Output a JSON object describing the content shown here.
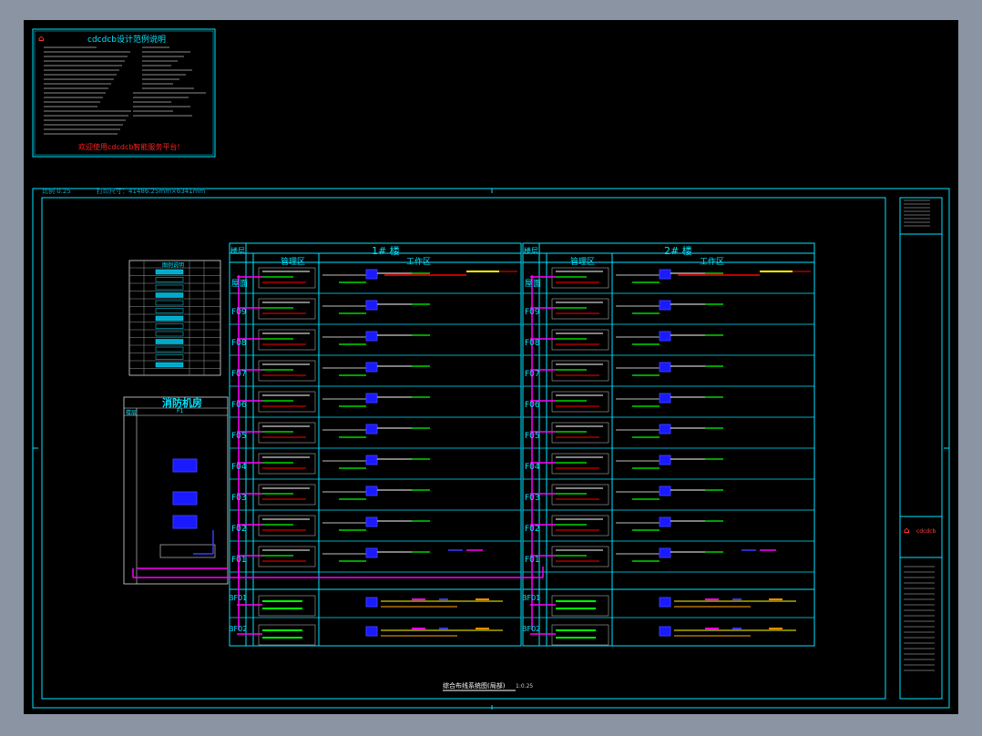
{
  "colors": {
    "background": "#000000",
    "frame": "#00e5ff",
    "accent": "#ff0000",
    "magenta": "#ff00ff",
    "green": "#00ff00",
    "blue": "#3a3aff",
    "yellow": "#ffff00",
    "white": "#ffffff"
  },
  "note_box": {
    "title": "cdcdcb设计范例说明",
    "footer": "欢迎使用cdcdcb智能服务平台!"
  },
  "sheet": {
    "scale_text": "比例 0.25",
    "print_size": "打印尺寸：41486.25mm×6341mm",
    "drawing_title": "综合布线系统图(局部)",
    "drawing_scale": "1:0.25"
  },
  "legend_table": {
    "title": "图例说明"
  },
  "machine_room": {
    "title": "消防机房",
    "col_floor": "楼层",
    "col_f1": "F1"
  },
  "buildings": [
    {
      "name": "1# 楼",
      "col_floor": "楼层",
      "col_manage": "管理区",
      "col_work": "工作区"
    },
    {
      "name": "2# 楼",
      "col_floor": "楼层",
      "col_manage": "管理区",
      "col_work": "工作区"
    }
  ],
  "floors": [
    "屋面",
    "F09",
    "F08",
    "F07",
    "F06",
    "F05",
    "F04",
    "F03",
    "F02",
    "F01"
  ],
  "basements": [
    "BF01",
    "BF02"
  ],
  "title_block": {
    "company": "cdcdcb"
  }
}
